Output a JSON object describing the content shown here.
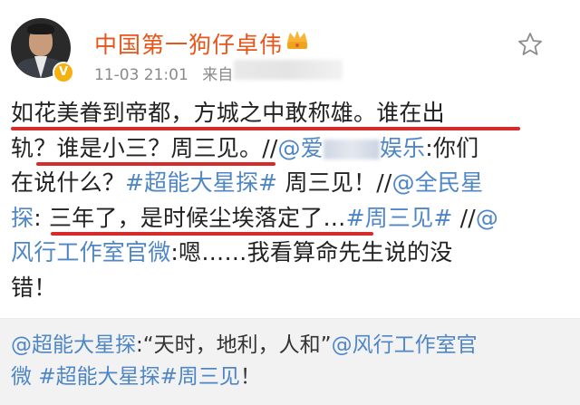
{
  "post": {
    "author": "中国第一狗仔卓伟",
    "timestamp": "11-03 21:01",
    "source_prefix": "来自",
    "verified_badge": "V",
    "icons": {
      "avatar": "user-avatar",
      "verified": "verified-icon",
      "crown": "crown-icon",
      "favorite": "star-icon"
    }
  },
  "body": {
    "l1": {
      "text": "如花美眷到帝都，方城之中敢称雄。谁在出"
    },
    "l2": {
      "a": "轨？谁是小三？周三见。//",
      "b": "@爱",
      "c": "娱乐",
      "d": ":你们"
    },
    "l3": {
      "a": "在说什么？",
      "b": "#超能大星探#",
      "c": " 周三见！//",
      "d": "@全民星"
    },
    "l4": {
      "a": "探",
      "b": ": 三年了，是时候尘埃落定了…",
      "c": "#周三见#",
      "d": " //",
      "e": "@"
    },
    "l5": {
      "a": "风行工作室官微",
      "b": ":嗯……我看算命先生说的没"
    },
    "l6": {
      "a": "错！"
    }
  },
  "repost": {
    "l1": {
      "a": "@超能大星探",
      "b": ":“天时，地利，人和”",
      "c": "@风行工作室官"
    },
    "l2": {
      "a": "微",
      "b": " ",
      "c": "#超能大星探#周三见",
      "d": "！"
    }
  },
  "colors": {
    "author": "#e8551a",
    "link": "#4f86c6",
    "underline": "#d52b2b",
    "repost_bg": "#f2f2f2"
  }
}
